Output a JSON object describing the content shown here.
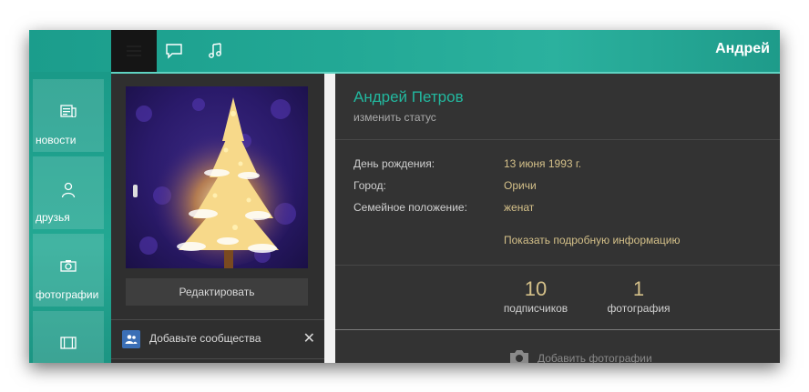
{
  "header": {
    "user_short_name": "Андрей",
    "icons": [
      "menu-icon",
      "chat-icon",
      "music-note-icon"
    ]
  },
  "sidebar": {
    "items": [
      {
        "label": "новости",
        "icon": "news-icon"
      },
      {
        "label": "друзья",
        "icon": "person-icon"
      },
      {
        "label": "фотографии",
        "icon": "camera-icon"
      },
      {
        "label": "",
        "icon": "film-icon"
      }
    ]
  },
  "profile_column": {
    "avatar_icon": "christmas-tree-photo",
    "edit_label": "Редактировать",
    "community_text": "Добавьте сообщества",
    "close_symbol": "✕"
  },
  "profile": {
    "full_name": "Андрей Петров",
    "status_link": "изменить статус",
    "birthday_label": "День рождения:",
    "birthday_value": "13 июня 1993 г.",
    "city_label": "Город:",
    "city_value": "Оричи",
    "family_label": "Семейное положение:",
    "family_value": "женат",
    "more_info": "Показать подробную информацию",
    "followers_count": "10",
    "followers_label": "подписчиков",
    "photos_count": "1",
    "photos_label": "фотография",
    "add_photos_label": "Добавить фотографии"
  },
  "colors": {
    "accent_teal": "#22b89f",
    "gold_text": "#d4c089",
    "panel_bg": "#333333"
  }
}
